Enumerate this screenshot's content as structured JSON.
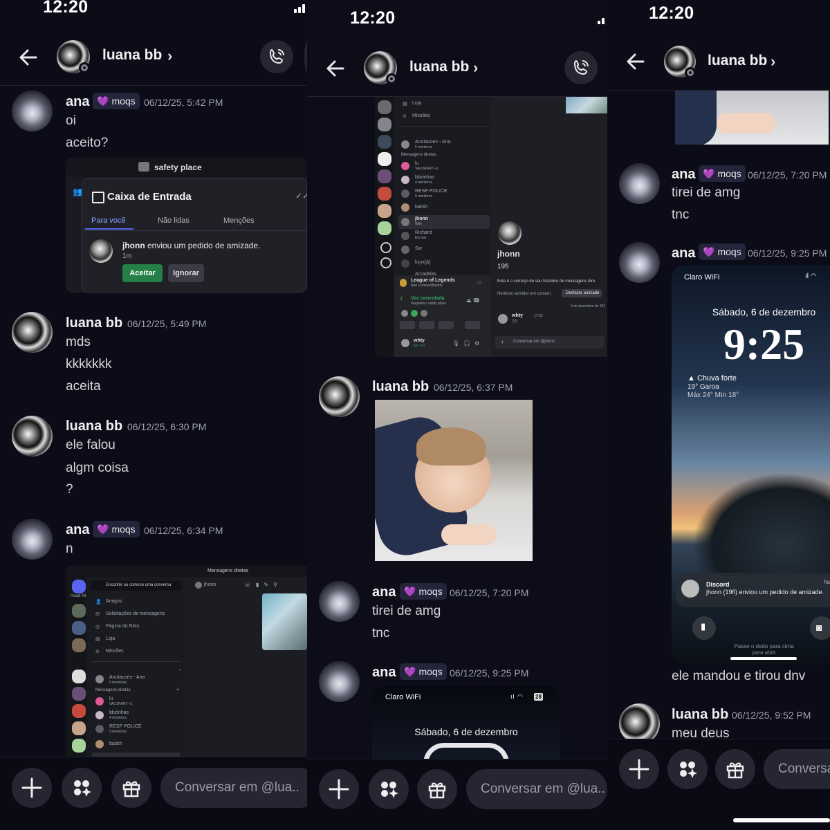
{
  "status_bar": {
    "time": "12:20"
  },
  "header": {
    "contact_name": "luana bb"
  },
  "composer": {
    "placeholder": "Conversar em @lua..",
    "placeholder_cut": "Conversa"
  },
  "panel1": {
    "messages": [
      {
        "author": "ana",
        "tag": "moqs",
        "time": "06/12/25, 5:42 PM",
        "lines": [
          "oi",
          "aceito?"
        ]
      },
      {
        "author": "luana bb",
        "time": "06/12/25, 5:49 PM",
        "lines": [
          "mds",
          "kkkkkkk",
          "aceita"
        ]
      },
      {
        "author": "luana bb",
        "time": "06/12/25, 6:30 PM",
        "lines": [
          "ele falou",
          "algm coisa",
          "?"
        ]
      },
      {
        "author": "ana",
        "tag": "moqs",
        "time": "06/12/25, 6:34 PM",
        "lines": [
          "n"
        ]
      }
    ],
    "inbox_shot": {
      "server": "safety place",
      "title": "Caixa de Entrada",
      "tabs": [
        "Para você",
        "Não lidas",
        "Menções"
      ],
      "notif_user": "jhonn",
      "notif_text": " enviou um pedido de amizade.",
      "notif_time": "1m",
      "accept": "Aceitar",
      "ignore": "Ignorar"
    },
    "dm_shot": {
      "top": "Mensagens diretas",
      "read_all": "Read All",
      "search": "Encontre ou comece uma conversa",
      "dm_name": "jhonn",
      "nav": [
        "Amigos",
        "Solicitações de mensagens",
        "Página do Nitro",
        "Loja",
        "Missões"
      ],
      "group": "Anotacoes - Ana",
      "group_sub": "5 membros",
      "section": "Mensagens diretas",
      "items": [
        "lu",
        "bbzinhas",
        "RESP POLICE",
        "balish"
      ],
      "item_subs": [
        "VALORANT +1",
        "4 membros",
        "9 membros",
        ""
      ]
    }
  },
  "panel2": {
    "sidebar_shot": {
      "nav": [
        "Loja",
        "Missões"
      ],
      "group": "Anotacoes - Ana",
      "group_sub": "5 membros",
      "section": "Mensagens diretas",
      "items": [
        "lu",
        "bbzinhas",
        "RESP POLICE",
        "balish",
        "jhonn",
        "Richard",
        "Sw",
        "kzyx[&]",
        "Arcadelas"
      ],
      "item_subs": [
        "VALORANT +1",
        "4 membros",
        "9 membros",
        "",
        "Wilo",
        "Em voz",
        "",
        "",
        ""
      ],
      "profile_name": "jhonn",
      "profile_handle": "19fi",
      "history": "Este é o começo do seu histórico de mensagens dire",
      "no_server": "Nenhum servidor em comum",
      "undo": "Desfazer amizade",
      "date": "6 de dezembro de 202",
      "msg_author": "whty",
      "msg_time": "17:53",
      "msg_text": "??",
      "game": "League of Legends",
      "game_sub": "Não Compartilhando",
      "voice": "Voz conectada",
      "voice_sub": "magnolia / safety place",
      "me": "whty",
      "me_sub": "Em voz",
      "composer": "Conversar em @jhonn"
    },
    "messages": [
      {
        "author": "luana bb",
        "time": "06/12/25, 6:37 PM"
      },
      {
        "author": "ana",
        "tag": "moqs",
        "time": "06/12/25, 7:20 PM",
        "lines": [
          "tirei de amg",
          "tnc"
        ]
      },
      {
        "author": "ana",
        "tag": "moqs",
        "time": "06/12/25, 9:25 PM"
      }
    ],
    "lock_partial": {
      "carrier": "Claro WiFi",
      "date": "Sábado, 6 de dezembro",
      "battery": "28"
    }
  },
  "panel3": {
    "messages": [
      {
        "author": "ana",
        "tag": "moqs",
        "time": "06/12/25, 7:20 PM",
        "lines": [
          "tirei de amg",
          "tnc"
        ]
      },
      {
        "author": "ana",
        "tag": "moqs",
        "time": "06/12/25, 9:25 PM",
        "lines": [
          "ele mandou e tirou dnv"
        ]
      },
      {
        "author": "luana bb",
        "time": "06/12/25, 9:52 PM",
        "lines": [
          "meu deus"
        ]
      }
    ],
    "lockscreen": {
      "carrier": "Claro WiFi",
      "date": "Sábado, 6 de dezembro",
      "clock": "9:25",
      "weather": "Chuva forte",
      "weather_sub": "19° Garoa",
      "weather_range": "Máx 24° Mín 18°",
      "notif_app": "Discord",
      "notif_text": "jhonn (19fi) enviou um pedido de amizade.",
      "notif_time": "ha",
      "swipe": "Passe o dedo para cima",
      "swipe2": "para abrir"
    }
  }
}
